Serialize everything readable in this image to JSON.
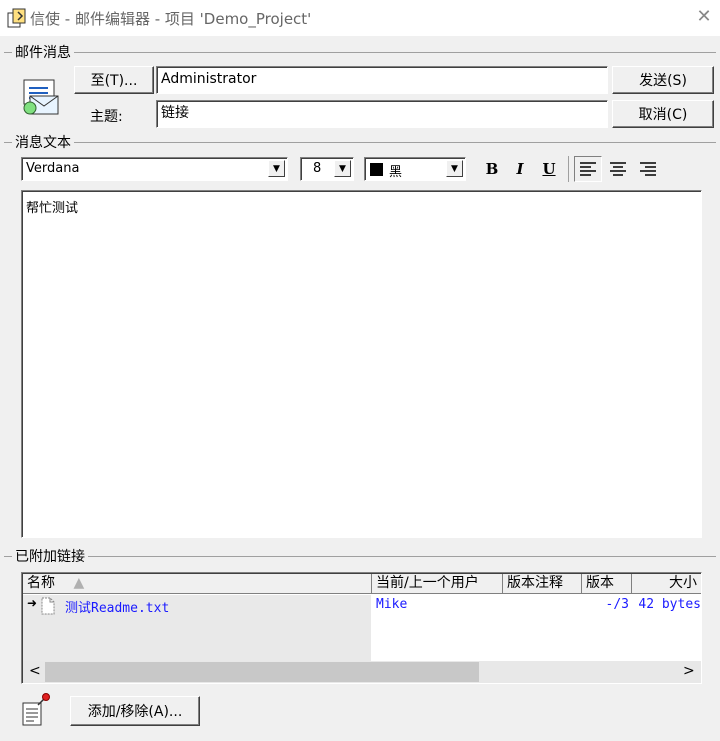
{
  "window": {
    "title": "信使 - 邮件编辑器 - 项目 'Demo_Project'",
    "close_symbol": "✕"
  },
  "message_group": {
    "label": "邮件消息",
    "to_button": "至(T)...",
    "to_value": "Administrator",
    "subject_label": "主题:",
    "subject_value": "链接",
    "send_button": "发送(S)",
    "cancel_button": "取消(C)"
  },
  "text_group": {
    "label": "消息文本",
    "font": "Verdana",
    "font_size": "8",
    "color_name": "黑",
    "bold": "B",
    "italic": "I",
    "underline": "U",
    "body": "帮忙测试"
  },
  "links_group": {
    "label": "已附加链接",
    "columns": [
      "名称",
      "当前/上一个用户",
      "版本注释",
      "版本",
      "大小"
    ],
    "rows": [
      {
        "name": "测试Readme.txt",
        "user": "Mike",
        "note": "",
        "version": "-/3",
        "size": "42 bytes"
      }
    ],
    "add_remove_button": "添加/移除(A)..."
  },
  "icons": {
    "app": "document-icon",
    "mail": "mail-envelope-icon",
    "pin": "pin-note-icon"
  }
}
